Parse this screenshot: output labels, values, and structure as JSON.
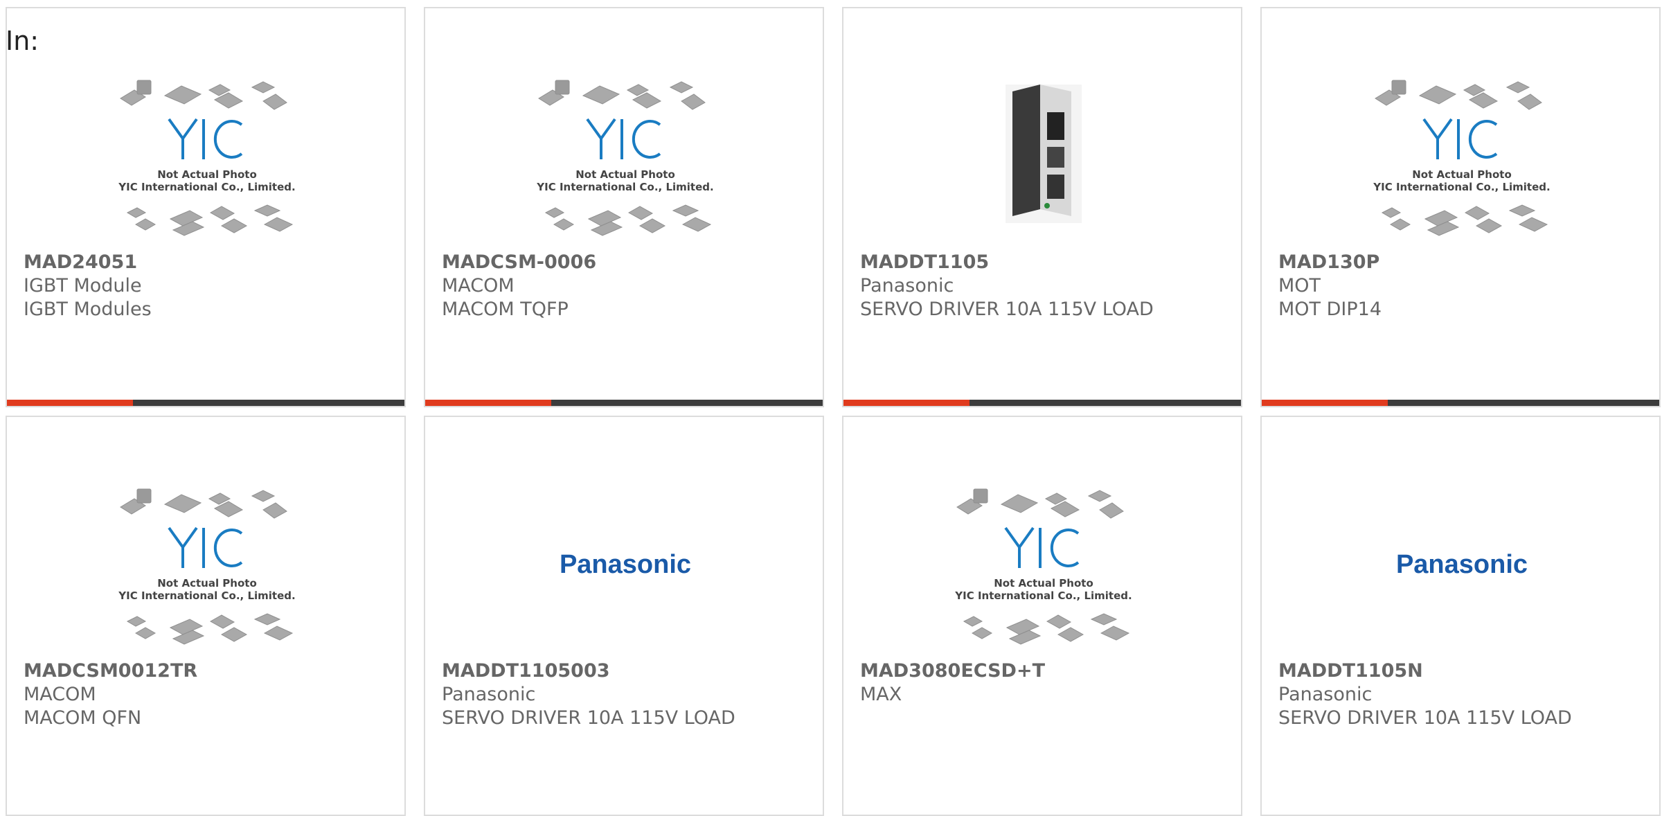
{
  "header": {
    "in_label": "In:"
  },
  "placeholder": {
    "logo": "YIC",
    "line1": "Not Actual Photo",
    "line2": "YIC International Co., Limited."
  },
  "brand_logo": "Panasonic",
  "products": [
    {
      "part": "MAD24051",
      "maker": "IGBT Module",
      "desc": "IGBT Modules",
      "image": "yic-placeholder",
      "accent_bar": true
    },
    {
      "part": "MADCSM-0006",
      "maker": "MACOM",
      "desc": "MACOM TQFP",
      "image": "yic-placeholder",
      "accent_bar": true
    },
    {
      "part": "MADDT1105",
      "maker": "Panasonic",
      "desc": "SERVO DRIVER 10A 115V LOAD",
      "image": "servo-driver-photo",
      "accent_bar": true
    },
    {
      "part": "MAD130P",
      "maker": "MOT",
      "desc": "MOT DIP14",
      "image": "yic-placeholder",
      "accent_bar": true
    },
    {
      "part": "MADCSM0012TR",
      "maker": "MACOM",
      "desc": "MACOM QFN",
      "image": "yic-placeholder",
      "accent_bar": false
    },
    {
      "part": "MADDT1105003",
      "maker": "Panasonic",
      "desc": "SERVO DRIVER 10A 115V LOAD",
      "image": "panasonic-logo",
      "accent_bar": false
    },
    {
      "part": "MAD3080ECSD+T",
      "maker": "MAX",
      "desc": "",
      "image": "yic-placeholder",
      "accent_bar": false
    },
    {
      "part": "MADDT1105N",
      "maker": "Panasonic",
      "desc": "SERVO DRIVER 10A 115V LOAD",
      "image": "panasonic-logo",
      "accent_bar": false
    }
  ],
  "colors": {
    "accent": "#e03b1e",
    "bar": "#3c3c3c",
    "border": "#dcdcdc",
    "text": "#666666",
    "logo_blue": "#1a7cc2"
  }
}
